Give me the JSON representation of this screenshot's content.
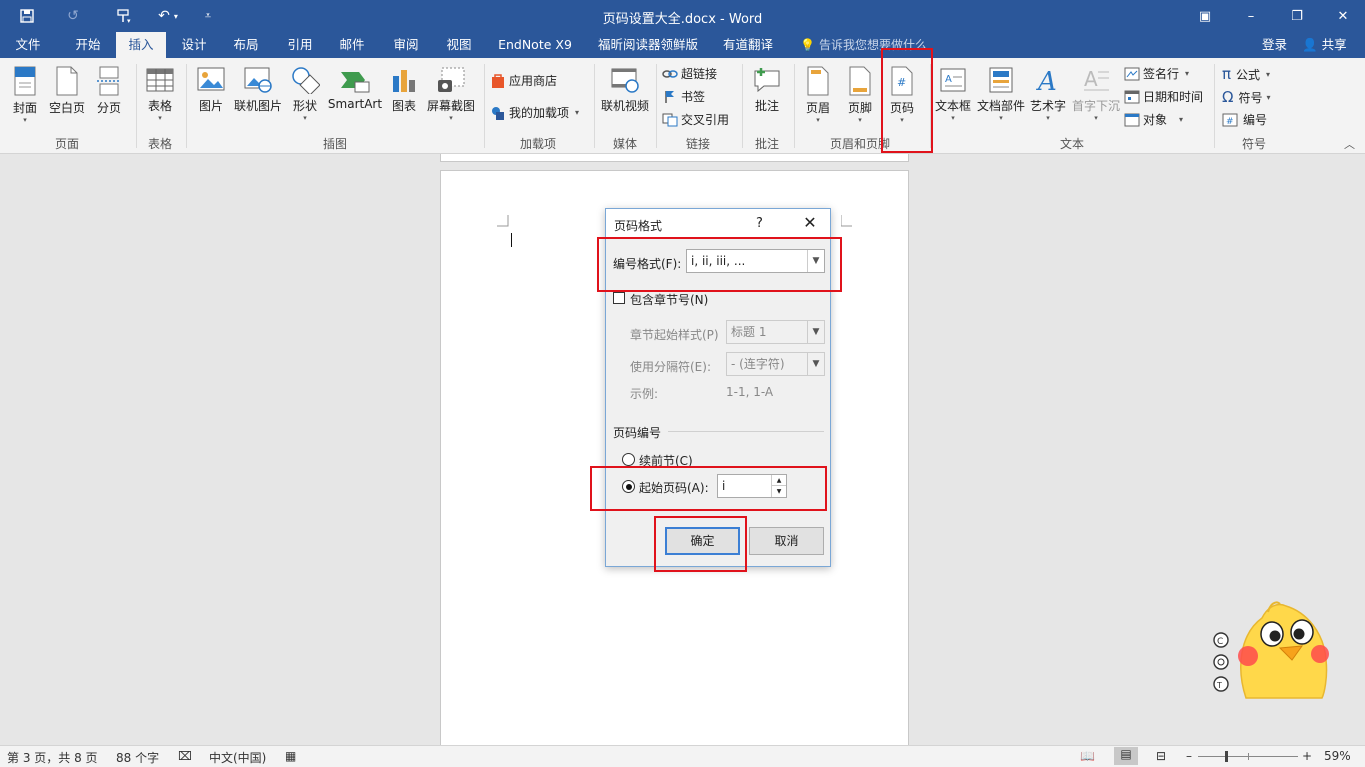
{
  "window": {
    "title": "页码设置大全.docx - Word",
    "minimize": "–",
    "restore": "❐",
    "close": "✕",
    "ribbon_display": "▣"
  },
  "quick_access": {
    "save": "save-icon",
    "redo": "↺",
    "undo": "↶"
  },
  "tabs": [
    {
      "label": "文件"
    },
    {
      "label": "开始"
    },
    {
      "label": "插入"
    },
    {
      "label": "设计"
    },
    {
      "label": "布局"
    },
    {
      "label": "引用"
    },
    {
      "label": "邮件"
    },
    {
      "label": "审阅"
    },
    {
      "label": "视图"
    },
    {
      "label": "EndNote X9"
    },
    {
      "label": "福昕阅读器领鲜版"
    },
    {
      "label": "有道翻译"
    }
  ],
  "tell_me": "告诉我您想要做什么",
  "login": "登录",
  "share": "共享",
  "ribbon": {
    "page": {
      "cover": "封面",
      "blank": "空白页",
      "break": "分页",
      "group": "页面"
    },
    "table": {
      "table": "表格",
      "group": "表格"
    },
    "illustrations": {
      "picture": "图片",
      "online_picture": "联机图片",
      "shapes": "形状",
      "smartart": "SmartArt",
      "chart": "图表",
      "screenshot": "屏幕截图",
      "group": "插图"
    },
    "addins": {
      "store": "应用商店",
      "my_addins": "我的加载项",
      "group": "加载项"
    },
    "media": {
      "online_video": "联机视频",
      "group": "媒体"
    },
    "links": {
      "hyperlink": "超链接",
      "bookmark": "书签",
      "cross_ref": "交叉引用",
      "group": "链接"
    },
    "comments": {
      "comment": "批注",
      "group": "批注"
    },
    "header_footer": {
      "header": "页眉",
      "footer": "页脚",
      "page_number": "页码",
      "group": "页眉和页脚"
    },
    "text": {
      "textbox": "文本框",
      "quick_parts": "文档部件",
      "wordart": "艺术字",
      "dropcap": "首字下沉",
      "signature": "签名行",
      "datetime": "日期和时间",
      "object": "对象",
      "group": "文本"
    },
    "symbols": {
      "equation": "公式",
      "symbol": "符号",
      "number": "编号",
      "group": "符号"
    }
  },
  "dialog": {
    "title": "页码格式",
    "help": "?",
    "close": "✕",
    "number_format_label": "编号格式(F):",
    "number_format_value": "i, ii, iii, ...",
    "include_chapter": "包含章节号(N)",
    "chapter_style_label": "章节起始样式(P)",
    "chapter_style_value": "标题 1",
    "separator_label": "使用分隔符(E):",
    "separator_value": "-   (连字符)",
    "example_label": "示例:",
    "example_value": "1-1, 1-A",
    "numbering_section": "页码编号",
    "continue_prev": "续前节(C)",
    "start_at": "起始页码(A):",
    "start_value": "i",
    "ok": "确定",
    "cancel": "取消"
  },
  "status": {
    "page": "第 3 页，共 8 页",
    "words": "88 个字",
    "language": "中文(中国)",
    "zoom": "59%",
    "zoom_level": 0.59
  },
  "colors": {
    "title_bar": "#2b579a",
    "highlight": "#e0121b"
  }
}
